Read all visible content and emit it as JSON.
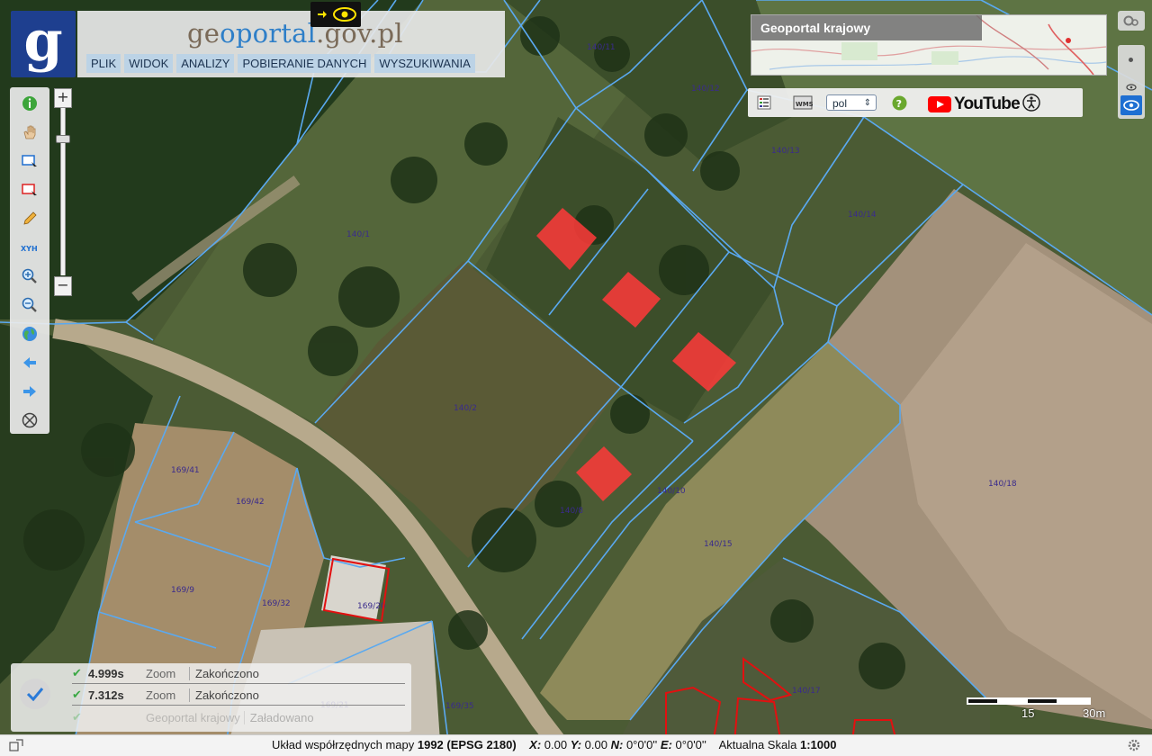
{
  "header": {
    "site_title_a": "ge",
    "site_title_b": "o",
    "site_title_c": "portal",
    "site_title_d": ".gov.pl",
    "logo_letter": "g",
    "menu": [
      "PLIK",
      "WIDOK",
      "ANALIZY",
      "POBIERANIE DANYCH",
      "WYSZUKIWANIA"
    ]
  },
  "overview": {
    "title": "Geoportal krajowy"
  },
  "top_tools": {
    "language": "pol",
    "youtube": "YouTube"
  },
  "map": {
    "parcels": [
      "140/11",
      "140/12",
      "140/13",
      "140/14",
      "140/1",
      "140/2",
      "140/8",
      "140/10",
      "140/15",
      "140/17",
      "140/18",
      "169/41",
      "169/42",
      "169/9",
      "169/32",
      "169/20",
      "169/35",
      "169/21"
    ]
  },
  "status": {
    "rows": [
      {
        "time": "4.999s",
        "action": "Zoom",
        "result": "Zakończono"
      },
      {
        "time": "7.312s",
        "action": "Zoom",
        "result": "Zakończono"
      },
      {
        "time": "",
        "action": "Geoportal krajowy",
        "result": "Załadowano"
      }
    ]
  },
  "scale": {
    "label_mid": "15",
    "label_end": "30m"
  },
  "bottom_bar": {
    "prefix": "Układ współrzędnych mapy",
    "crs": "1992 (EPSG 2180)",
    "x_label": "X:",
    "x_value": "0.00",
    "y_label": "Y:",
    "y_value": "0.00",
    "n_label": "N:",
    "n_value": "0°0'0''",
    "e_label": "E:",
    "e_value": "0°0'0''",
    "scale_label": "Aktualna Skala",
    "scale_value": "1:1000"
  },
  "colors": {
    "parcel_line": "#5aa9f0",
    "marker": "#ff3a3a",
    "building_outline": "#e21010",
    "logo_bg": "#1e3f8f",
    "menu_bg": "#bcd3e6"
  }
}
